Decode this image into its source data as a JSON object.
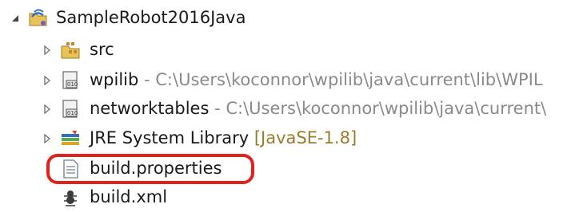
{
  "project": {
    "name": "SampleRobot2016Java",
    "icon": "java-project-icon"
  },
  "children": [
    {
      "name": "src",
      "decoration": "",
      "icon": "source-folder-icon",
      "expandable": true
    },
    {
      "name": "wpilib",
      "decoration": " - C:\\Users\\koconnor\\wpilib\\java\\current\\lib\\WPIL",
      "icon": "jar-icon",
      "expandable": true
    },
    {
      "name": "networktables",
      "decoration": " - C:\\Users\\koconnor\\wpilib\\java\\current\\",
      "icon": "jar-icon",
      "expandable": true
    },
    {
      "name": "JRE System Library",
      "decoration": " [JavaSE-1.8]",
      "icon": "library-icon",
      "expandable": true
    },
    {
      "name": "build.properties",
      "decoration": "",
      "icon": "properties-file-icon",
      "expandable": false,
      "highlighted": true
    },
    {
      "name": "build.xml",
      "decoration": "",
      "icon": "ant-file-icon",
      "expandable": false
    }
  ],
  "colors": {
    "highlight": "#e0211d",
    "decoration": "#8a8a8a",
    "jre_decoration": "#9c7a2c"
  }
}
